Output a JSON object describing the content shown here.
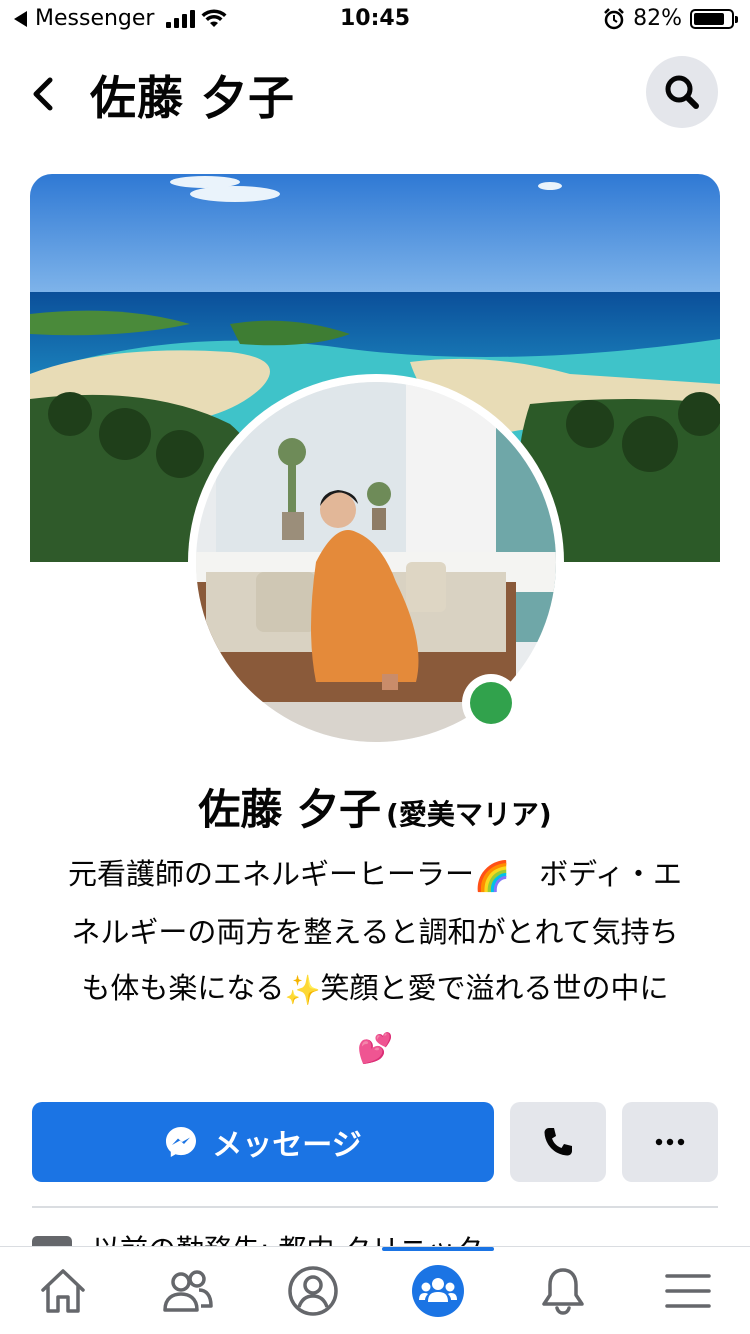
{
  "status_bar": {
    "back_app": "Messenger",
    "time": "10:45",
    "battery": "82%",
    "battery_level": 0.82
  },
  "header": {
    "title": "佐藤 夕子"
  },
  "profile": {
    "name": "佐藤 夕子",
    "alt_name": "(愛美マリア)",
    "bio_line1": "元看護師のエネルギーヒーラー",
    "bio_emoji1": "🌈",
    "bio_line1b": "ボディ・エ",
    "bio_line2": "ネルギーの両方を整えると調和がとれて気持ち",
    "bio_line3a": "も体も楽になる",
    "bio_emoji2": "✨",
    "bio_line3b": "笑顔と愛で溢れる世の中に",
    "bio_emoji3": "💕",
    "online": true
  },
  "actions": {
    "message_label": "メッセージ",
    "call_icon": "phone-icon",
    "more_icon": "more-icon"
  },
  "intro": {
    "partial_text": "以前の勤務先: 都内 クリニック"
  },
  "tabs": [
    {
      "name": "home",
      "icon": "home-icon"
    },
    {
      "name": "friends",
      "icon": "friends-icon"
    },
    {
      "name": "profile",
      "icon": "profile-icon"
    },
    {
      "name": "groups",
      "icon": "groups-icon",
      "active": true
    },
    {
      "name": "notifications",
      "icon": "bell-icon"
    },
    {
      "name": "menu",
      "icon": "menu-icon"
    }
  ],
  "colors": {
    "accent": "#1b74e4",
    "online": "#31a24c",
    "button_gray": "#e4e6eb"
  }
}
